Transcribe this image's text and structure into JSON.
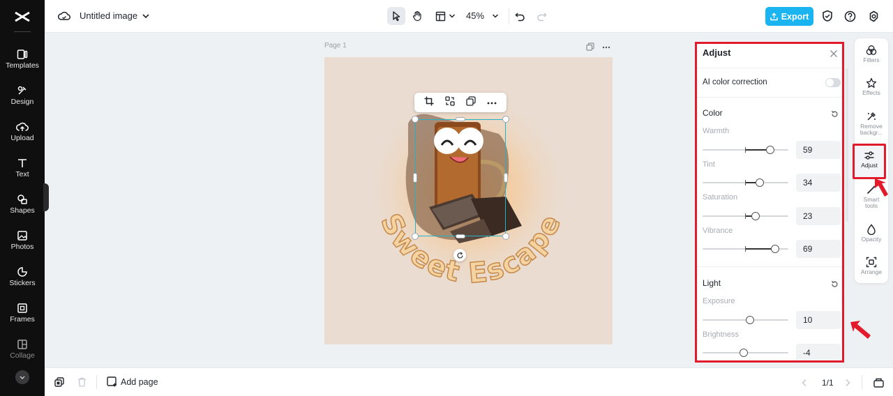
{
  "brand": {
    "name": "CapCut",
    "accent": "#1ab5f0",
    "highlight": "#e21b2c",
    "selection": "#21b3c7"
  },
  "sidebar": {
    "items": [
      {
        "label": "Templates",
        "icon": "templates-icon"
      },
      {
        "label": "Design",
        "icon": "design-icon"
      },
      {
        "label": "Upload",
        "icon": "upload-icon"
      },
      {
        "label": "Text",
        "icon": "text-icon"
      },
      {
        "label": "Shapes",
        "icon": "shapes-icon"
      },
      {
        "label": "Photos",
        "icon": "photos-icon"
      },
      {
        "label": "Stickers",
        "icon": "stickers-icon"
      },
      {
        "label": "Frames",
        "icon": "frames-icon"
      },
      {
        "label": "Collage",
        "icon": "collage-icon"
      }
    ]
  },
  "header": {
    "title": "Untitled image",
    "zoom": "45%",
    "export_label": "Export"
  },
  "canvas": {
    "page_label": "Page 1",
    "artwork_text": "Sweet Escape"
  },
  "footer": {
    "add_page_label": "Add page",
    "pager": "1/1"
  },
  "adjust_panel": {
    "title": "Adjust",
    "ai_color_label": "AI color correction",
    "ai_color_enabled": false,
    "color": {
      "label": "Color",
      "sliders": [
        {
          "label": "Warmth",
          "value": "59"
        },
        {
          "label": "Tint",
          "value": "34"
        },
        {
          "label": "Saturation",
          "value": "23"
        },
        {
          "label": "Vibrance",
          "value": "69"
        }
      ]
    },
    "light": {
      "label": "Light",
      "sliders": [
        {
          "label": "Exposure",
          "value": "10"
        },
        {
          "label": "Brightness",
          "value": "-4"
        }
      ]
    }
  },
  "tools": {
    "items": [
      {
        "label": "Filters",
        "icon": "filters-icon"
      },
      {
        "label": "Effects",
        "icon": "effects-icon"
      },
      {
        "label": "Remove backgr...",
        "icon": "remove-background-icon"
      },
      {
        "label": "Adjust",
        "icon": "adjust-icon",
        "active": true
      },
      {
        "label": "Smart tools",
        "icon": "smart-tools-icon"
      },
      {
        "label": "Opacity",
        "icon": "opacity-icon"
      },
      {
        "label": "Arrange",
        "icon": "arrange-icon"
      }
    ]
  }
}
